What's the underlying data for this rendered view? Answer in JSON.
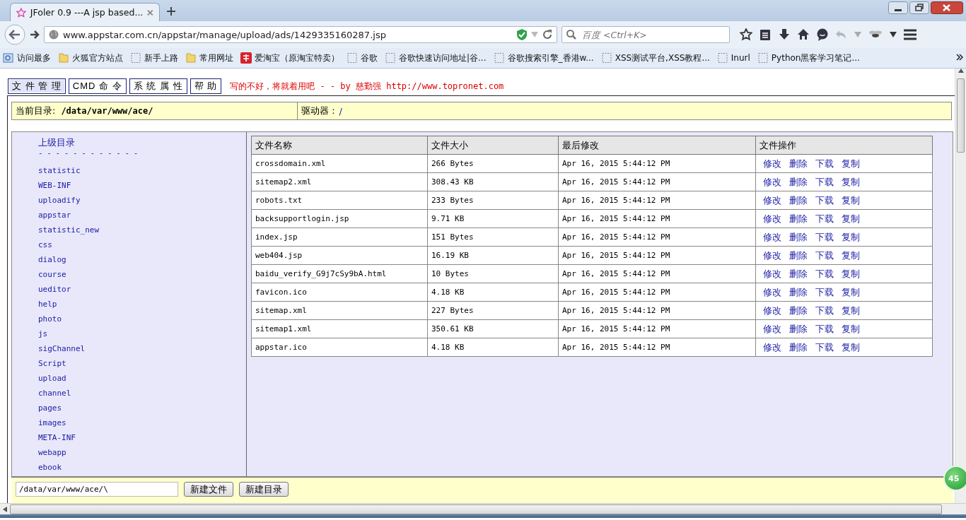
{
  "browser": {
    "tab": {
      "title": "JFoler 0.9 ---A jsp based...",
      "selected": true
    },
    "address": "www.appstar.com.cn/appstar/manage/upload/ads/1429335160287.jsp",
    "search": {
      "placeholder": "百度 <Ctrl+K>"
    },
    "bookmarks": [
      {
        "kind": "history",
        "label": "访问最多"
      },
      {
        "kind": "folder",
        "label": "火狐官方站点"
      },
      {
        "kind": "page",
        "label": "新手上路"
      },
      {
        "kind": "folder",
        "label": "常用网址"
      },
      {
        "kind": "taobao",
        "label": "爱淘宝（原淘宝特卖）"
      },
      {
        "kind": "page",
        "label": "谷歌"
      },
      {
        "kind": "page",
        "label": "谷歌快速访问地址|谷..."
      },
      {
        "kind": "page",
        "label": "谷歌搜索引擎_香港w..."
      },
      {
        "kind": "page",
        "label": "XSS测试平台,XSS教程..."
      },
      {
        "kind": "page",
        "label": "Inurl"
      },
      {
        "kind": "page",
        "label": "Python黑客学习笔记..."
      }
    ]
  },
  "menu": {
    "tabs": [
      {
        "label": "文 件 管 理",
        "selected": true
      },
      {
        "label": "CMD 命 令",
        "selected": false
      },
      {
        "label": "系 统 属 性",
        "selected": false
      },
      {
        "label": "帮 助",
        "selected": false
      }
    ],
    "credit": "写的不好，将就着用吧 - - by 慈勤强 http://www.topronet.com"
  },
  "location": {
    "label": "当前目录:",
    "path": "/data/var/www/ace/",
    "drives_label": "驱动器 :",
    "drives": [
      "/"
    ]
  },
  "sidebar": {
    "parent": "上级目录",
    "separator": "- - - - - - - - - - - -",
    "folders": [
      "statistic",
      "WEB-INF",
      "uploadify",
      "appstar",
      "statistic_new",
      "css",
      "dialog",
      "course",
      "ueditor",
      "help",
      "photo",
      "js",
      "sigChannel",
      "Script",
      "upload",
      "channel",
      "pages",
      "images",
      "META-INF",
      "webapp",
      "ebook"
    ]
  },
  "table": {
    "columns": [
      "文件名称",
      "文件大小",
      "最后修改",
      "文件操作"
    ],
    "rows": [
      {
        "name": "crossdomain.xml",
        "size": "266 Bytes",
        "modified": "Apr 16, 2015 5:44:12 PM",
        "actions": [
          "修改",
          "删除",
          "下载",
          "复制"
        ]
      },
      {
        "name": "sitemap2.xml",
        "size": "308.43 KB",
        "modified": "Apr 16, 2015 5:44:12 PM",
        "actions": [
          "修改",
          "删除",
          "下载",
          "复制"
        ]
      },
      {
        "name": "robots.txt",
        "size": "233 Bytes",
        "modified": "Apr 16, 2015 5:44:12 PM",
        "actions": [
          "修改",
          "删除",
          "下载",
          "复制"
        ]
      },
      {
        "name": "backsupportlogin.jsp",
        "size": "9.71 KB",
        "modified": "Apr 16, 2015 5:44:12 PM",
        "actions": [
          "修改",
          "删除",
          "下载",
          "复制"
        ]
      },
      {
        "name": "index.jsp",
        "size": "151 Bytes",
        "modified": "Apr 16, 2015 5:44:12 PM",
        "actions": [
          "修改",
          "删除",
          "下载",
          "复制"
        ]
      },
      {
        "name": "web404.jsp",
        "size": "16.19 KB",
        "modified": "Apr 16, 2015 5:44:12 PM",
        "actions": [
          "修改",
          "删除",
          "下载",
          "复制"
        ]
      },
      {
        "name": "baidu_verify_G9j7cSy9bA.html",
        "size": "10 Bytes",
        "modified": "Apr 16, 2015 5:44:12 PM",
        "actions": [
          "修改",
          "删除",
          "下载",
          "复制"
        ]
      },
      {
        "name": "favicon.ico",
        "size": "4.18 KB",
        "modified": "Apr 16, 2015 5:44:12 PM",
        "actions": [
          "修改",
          "删除",
          "下载",
          "复制"
        ]
      },
      {
        "name": "sitemap.xml",
        "size": "227 Bytes",
        "modified": "Apr 16, 2015 5:44:12 PM",
        "actions": [
          "修改",
          "删除",
          "下载",
          "复制"
        ]
      },
      {
        "name": "sitemap1.xml",
        "size": "350.61 KB",
        "modified": "Apr 16, 2015 5:44:12 PM",
        "actions": [
          "修改",
          "删除",
          "下载",
          "复制"
        ]
      },
      {
        "name": "appstar.ico",
        "size": "4.18 KB",
        "modified": "Apr 16, 2015 5:44:12 PM",
        "actions": [
          "修改",
          "删除",
          "下载",
          "复制"
        ]
      }
    ]
  },
  "create": {
    "path": "/data/var/www/ace/\\",
    "buttons": [
      "新建文件",
      "新建目录"
    ]
  },
  "badge": "45"
}
